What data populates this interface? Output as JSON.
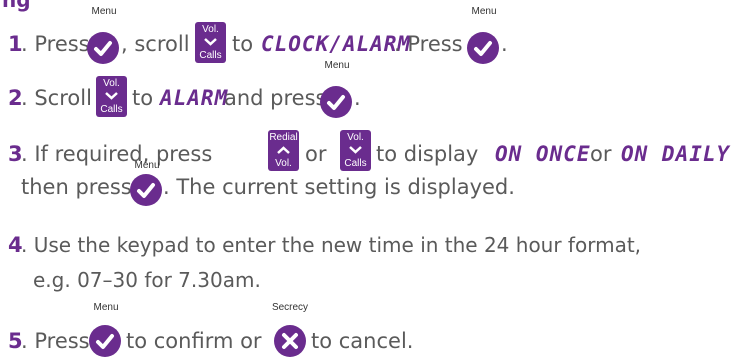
{
  "header": {
    "partial_title": "ng"
  },
  "keys": {
    "menu_label": "Menu",
    "secrecy_label": "Secrecy",
    "vol_label": "Vol.",
    "calls_label": "Calls",
    "redial_label": "Redial",
    "accent_color": "#6a2c8e"
  },
  "steps": [
    {
      "number": "1",
      "t1": ". Press",
      "t2": ", scroll",
      "t3": "to",
      "lcd1": "CLOCK/ALARM",
      "t4": ". Press",
      "t5": "."
    },
    {
      "number": "2",
      "t1": ". Scroll",
      "t2": "to",
      "lcd1": "ALARM",
      "t3": "and press",
      "t4": "."
    },
    {
      "number": "3",
      "t1": ". If required, press",
      "t2": "or",
      "t3": "to display",
      "lcd1": "ON ONCE",
      "t4": "or",
      "lcd2": "ON DAILY",
      "line2a": "then press",
      "line2b": ". The current setting is displayed."
    },
    {
      "number": "4",
      "line1": ". Use the keypad to enter the new time in the 24 hour format,",
      "line2": "e.g. 07–30 for 7.30am."
    },
    {
      "number": "5",
      "t1": ". Press",
      "t2": "to confirm or",
      "t3": "to cancel."
    }
  ]
}
